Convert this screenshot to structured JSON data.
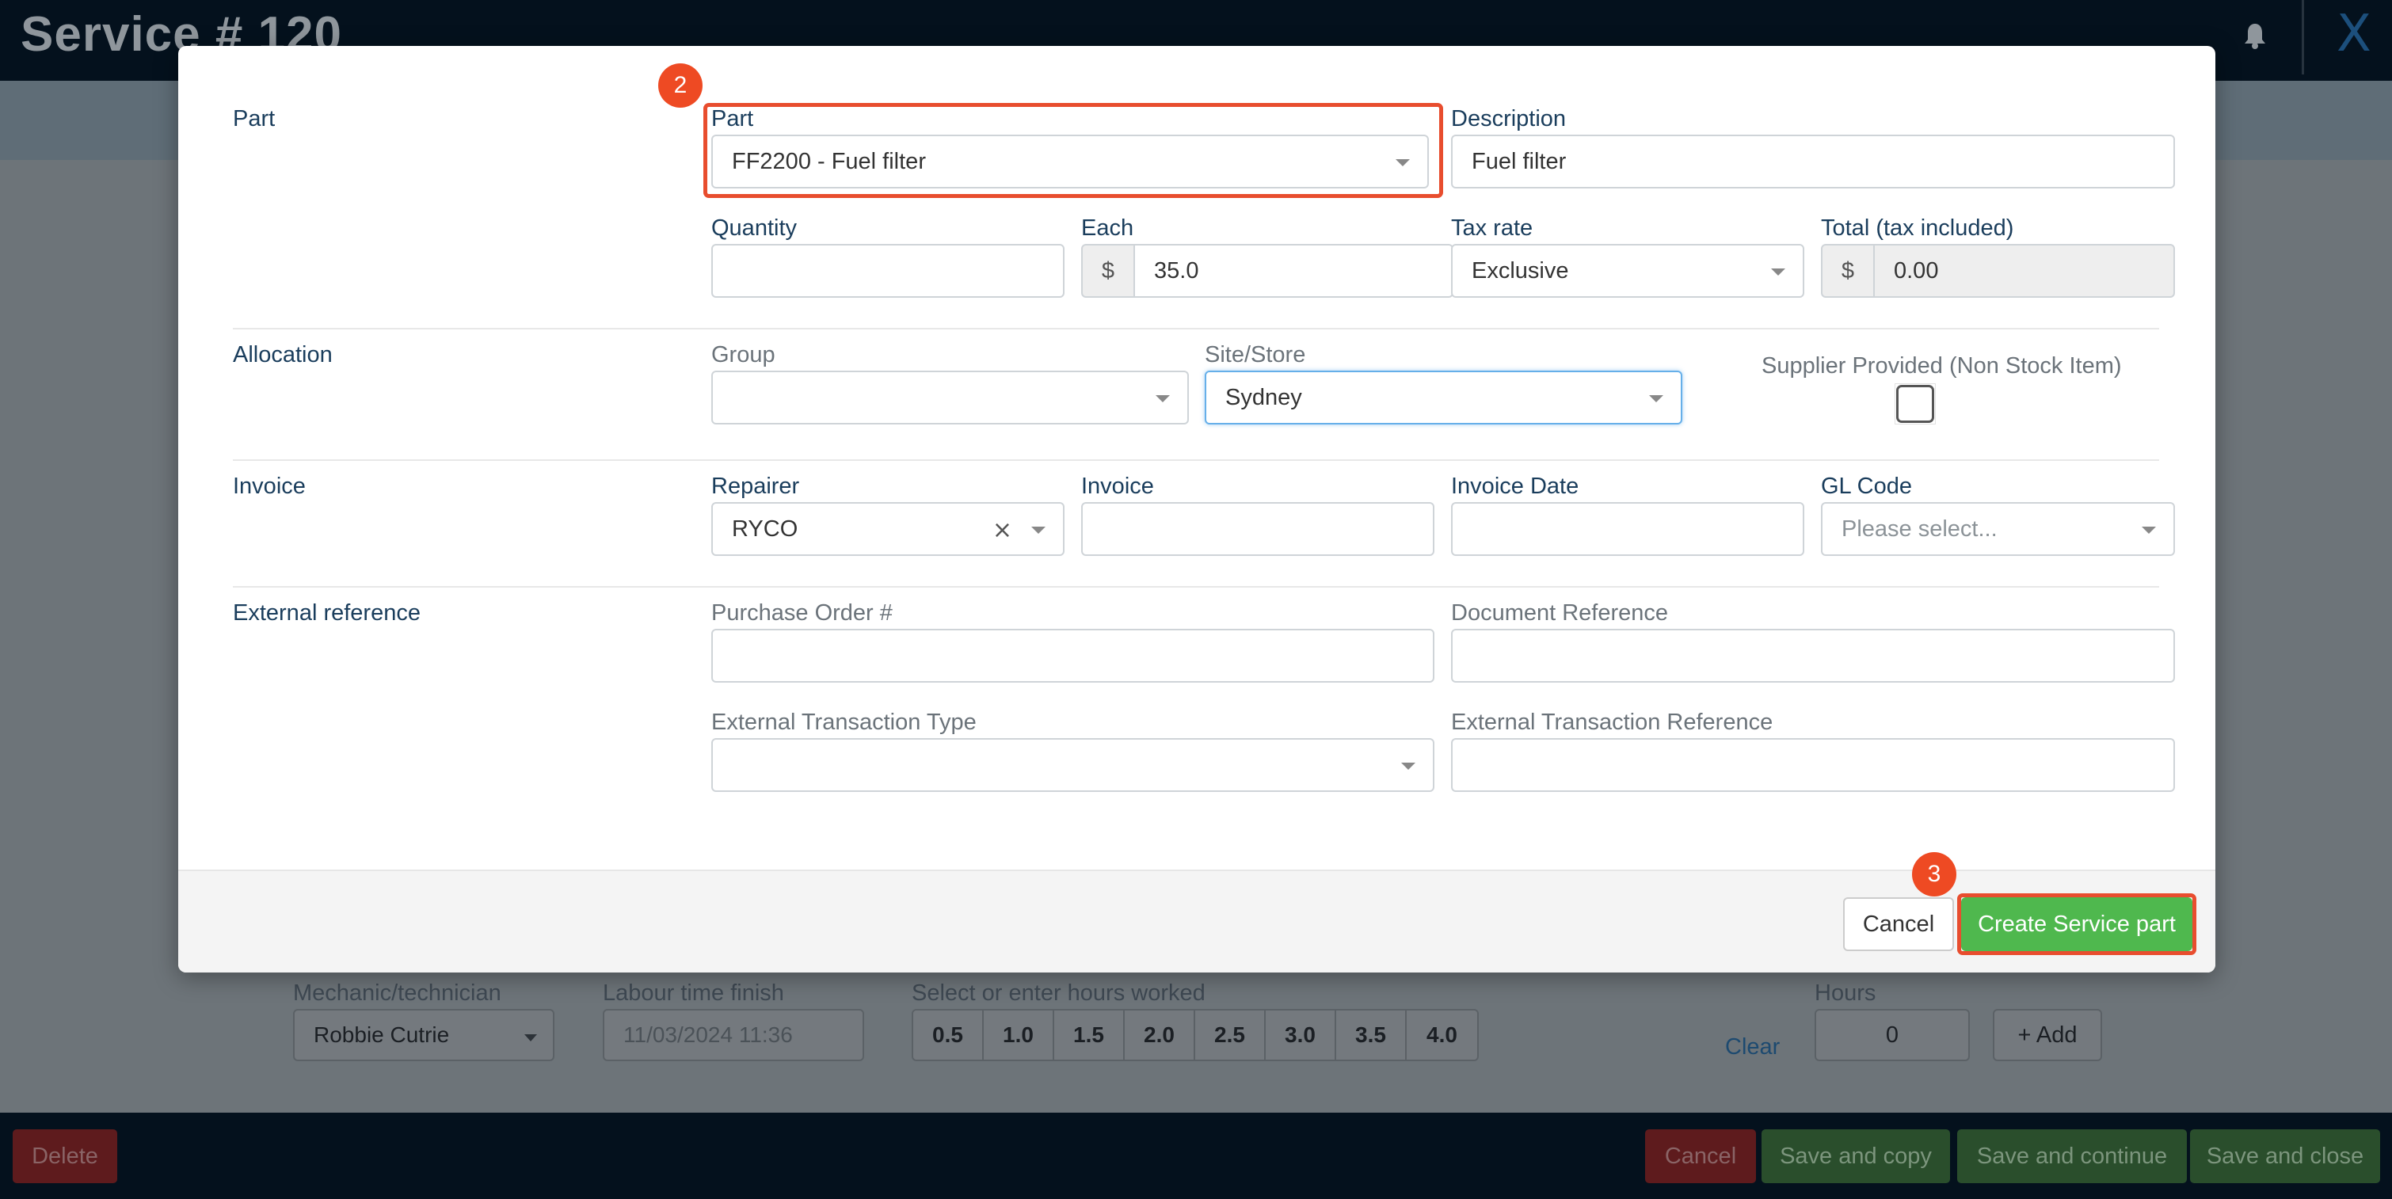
{
  "background": {
    "page_title": "Service # 120",
    "close_label": "X",
    "labour": {
      "mechanic_label": "Mechanic/technician",
      "mechanic_value": "Robbie Cutrie",
      "finish_label": "Labour time finish",
      "finish_value": "11/03/2024 11:36",
      "hours_worked_label": "Select or enter hours worked",
      "hour_options": [
        "0.5",
        "1.0",
        "1.5",
        "2.0",
        "2.5",
        "3.0",
        "3.5",
        "4.0"
      ],
      "clear_label": "Clear",
      "hours_label": "Hours",
      "hours_value": "0",
      "add_label": "+ Add"
    },
    "bottom_bar": {
      "delete_label": "Delete",
      "cancel_label": "Cancel",
      "save_copy_label": "Save and copy",
      "save_continue_label": "Save and continue",
      "save_close_label": "Save and close"
    }
  },
  "modal": {
    "sections": {
      "part": "Part",
      "allocation": "Allocation",
      "invoice": "Invoice",
      "external_reference": "External reference"
    },
    "part": {
      "part_label": "Part",
      "part_value": "FF2200 - Fuel filter",
      "description_label": "Description",
      "description_value": "Fuel filter",
      "quantity_label": "Quantity",
      "quantity_value": "",
      "each_label": "Each",
      "each_currency": "$",
      "each_value": "35.0",
      "tax_rate_label": "Tax rate",
      "tax_rate_value": "Exclusive",
      "total_label": "Total (tax included)",
      "total_currency": "$",
      "total_value": "0.00"
    },
    "allocation": {
      "group_label": "Group",
      "group_value": "",
      "site_label": "Site/Store",
      "site_value": "Sydney",
      "supplier_provided_label": "Supplier Provided (Non Stock Item)",
      "supplier_provided_checked": false
    },
    "invoice": {
      "repairer_label": "Repairer",
      "repairer_value": "RYCO",
      "invoice_label": "Invoice",
      "invoice_value": "",
      "invoice_date_label": "Invoice Date",
      "invoice_date_value": "",
      "gl_code_label": "GL Code",
      "gl_code_placeholder": "Please select..."
    },
    "external": {
      "po_label": "Purchase Order #",
      "po_value": "",
      "doc_ref_label": "Document Reference",
      "doc_ref_value": "",
      "ext_type_label": "External Transaction Type",
      "ext_type_value": "",
      "ext_ref_label": "External Transaction Reference",
      "ext_ref_value": ""
    },
    "footer": {
      "cancel_label": "Cancel",
      "create_label": "Create Service part"
    }
  },
  "annotations": {
    "step_part": "2",
    "step_create": "3",
    "highlight_color": "#e84d2e"
  },
  "colors": {
    "primary_green": "#4fb84e",
    "label_blue": "#1a3d5c",
    "danger_red": "#d9534f"
  }
}
